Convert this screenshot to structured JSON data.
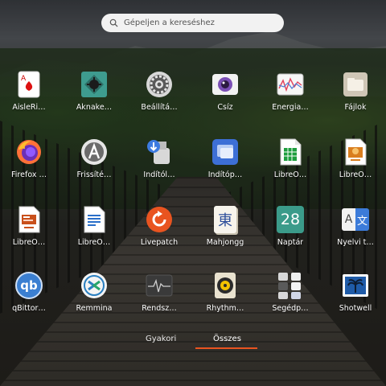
{
  "search": {
    "placeholder": "Gépeljen a kereséshez",
    "icon": "search-icon"
  },
  "apps": [
    {
      "label": "AisleRi…",
      "icon": "card-game-icon"
    },
    {
      "label": "Aknake…",
      "icon": "minesweeper-icon"
    },
    {
      "label": "Beállítá…",
      "icon": "settings-icon"
    },
    {
      "label": "Csíz",
      "icon": "camera-icon"
    },
    {
      "label": "Energia…",
      "icon": "power-stats-icon"
    },
    {
      "label": "Fájlok",
      "icon": "folder-icon"
    },
    {
      "label": "Firefox …",
      "icon": "firefox-icon"
    },
    {
      "label": "Frissíté…",
      "icon": "software-updater-icon"
    },
    {
      "label": "Indítól…",
      "icon": "usb-startup-icon"
    },
    {
      "label": "Indítóp…",
      "icon": "startup-apps-icon"
    },
    {
      "label": "LibreO…",
      "icon": "libreoffice-calc-icon"
    },
    {
      "label": "LibreO…",
      "icon": "libreoffice-impress-icon"
    },
    {
      "label": "LibreO…",
      "icon": "libreoffice-presentation-icon"
    },
    {
      "label": "LibreO…",
      "icon": "libreoffice-writer-icon"
    },
    {
      "label": "Livepatch",
      "icon": "livepatch-icon"
    },
    {
      "label": "Mahjongg",
      "icon": "mahjongg-icon"
    },
    {
      "label": "Naptár",
      "icon": "calendar-icon"
    },
    {
      "label": "Nyelvi t…",
      "icon": "language-support-icon"
    },
    {
      "label": "qBittor…",
      "icon": "qbittorrent-icon"
    },
    {
      "label": "Remmina",
      "icon": "remmina-icon"
    },
    {
      "label": "Rendsz…",
      "icon": "system-monitor-icon"
    },
    {
      "label": "Rhythm…",
      "icon": "rhythmbox-icon"
    },
    {
      "label": "Segédp…",
      "icon": "utilities-folder-icon"
    },
    {
      "label": "Shotwell",
      "icon": "shotwell-icon"
    }
  ],
  "calendar_day": "28",
  "mahjongg_glyph": "東",
  "language_glyphs": {
    "a": "A",
    "b": "文"
  },
  "qbit_text": "qb",
  "tabs": {
    "frequent": "Gyakori",
    "all": "Összes"
  },
  "colors": {
    "accent": "#e95420"
  }
}
